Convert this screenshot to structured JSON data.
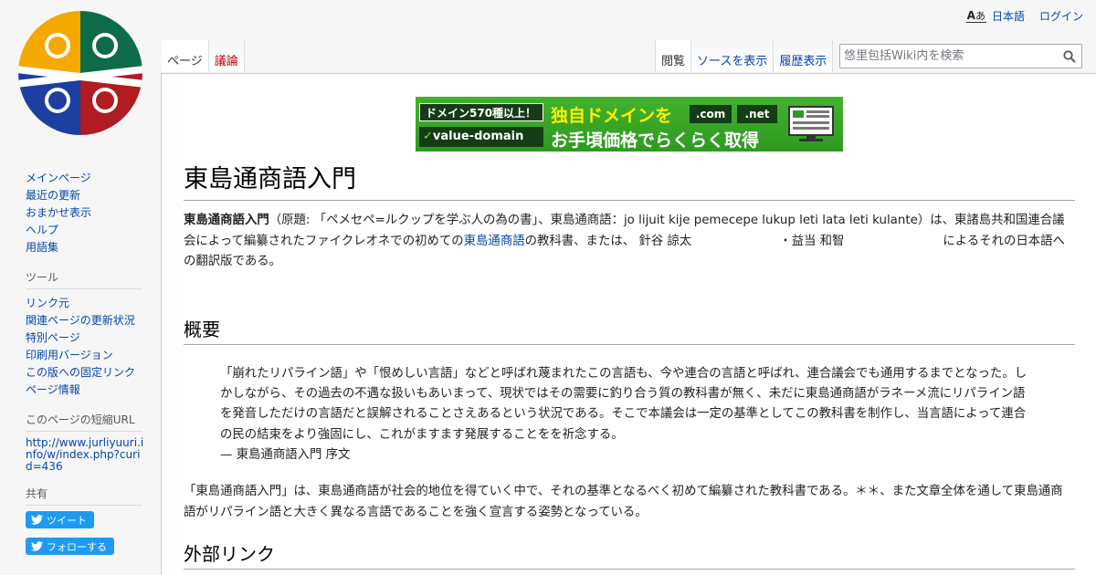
{
  "personal": {
    "lang_icon_big": "A",
    "lang_icon_small": "あ",
    "language": "日本語",
    "login": "ログイン"
  },
  "tabs": {
    "page": "ページ",
    "talk": "議論",
    "read": "閲覧",
    "view_source": "ソースを表示",
    "history": "履歴表示"
  },
  "search": {
    "placeholder": "悠里包括Wiki内を検索",
    "value": ""
  },
  "banner": {
    "badge": "ドメイン570種以上！",
    "logo": "value-domain",
    "headline1": "独自ドメインを",
    "headline2": "お手頃価格でらくらく取得",
    "com": ".com",
    "net": ".net"
  },
  "sidebar": {
    "nav": [
      {
        "label": "メインページ"
      },
      {
        "label": "最近の更新"
      },
      {
        "label": "おまかせ表示"
      },
      {
        "label": "ヘルプ"
      },
      {
        "label": "用語集"
      }
    ],
    "tools_heading": "ツール",
    "tools": [
      {
        "label": "リンク元"
      },
      {
        "label": "関連ページの更新状況"
      },
      {
        "label": "特別ページ"
      },
      {
        "label": "印刷用バージョン"
      },
      {
        "label": "この版への固定リンク"
      },
      {
        "label": "ページ情報"
      }
    ],
    "short_url_heading": "このページの短縮URL",
    "short_url": "http://www.jurliyuuri.info/w/index.php?curid=436",
    "share_heading": "共有",
    "tweet": "ツイート",
    "follow": "フォローする"
  },
  "article": {
    "title": "東島通商語入門",
    "intro": {
      "bold": "東島通商語入門",
      "part1": "（原題: 「ペメセペ=ルクップを学ぶ人の為の書」、東島通商語：jo lijuit kije pemecepe lukup leti lata leti kulante）は、東諸島共和国連合議会によって編纂されたファイクレオネでの初めての",
      "link": "東島通商語",
      "part2": "の教科書、または、 針谷 諒太",
      "part3": "・益当 和智",
      "part4": "によるそれの日本語への翻訳版である。"
    },
    "overview_heading": "概要",
    "quote_lines": [
      "「崩れたリパライン語」や「恨めしい言語」などと呼ばれ蔑まれたこの言語も、今や連合の言語と呼ばれ、連合議会でも通用するまでとなった。しかしながら、その過去の不遇な扱いもあいまって、現状ではその需要に釣り合う質の教科書が無く、未だに東島通商語がラネーメ流にリパライン語を発音しただけの言語だと誤解されることさえあるという状況である。そこで本議会は一定の基準としてこの教科書を制作し、当言語によって連合の民の結束をより強固にし、これがますます発展することをを祈念する。"
    ],
    "quote_source": "— 東島通商語入門 序文",
    "para2": "「東島通商語入門」は、東島通商語が社会的地位を得ていく中で、それの基準となるべく初めて編纂された教科書である。＊＊、また文章全体を通して東島通商語がリパライン語と大きく異なる言語であることを強く宣言する姿勢となっている。",
    "links_heading": "外部リンク"
  }
}
